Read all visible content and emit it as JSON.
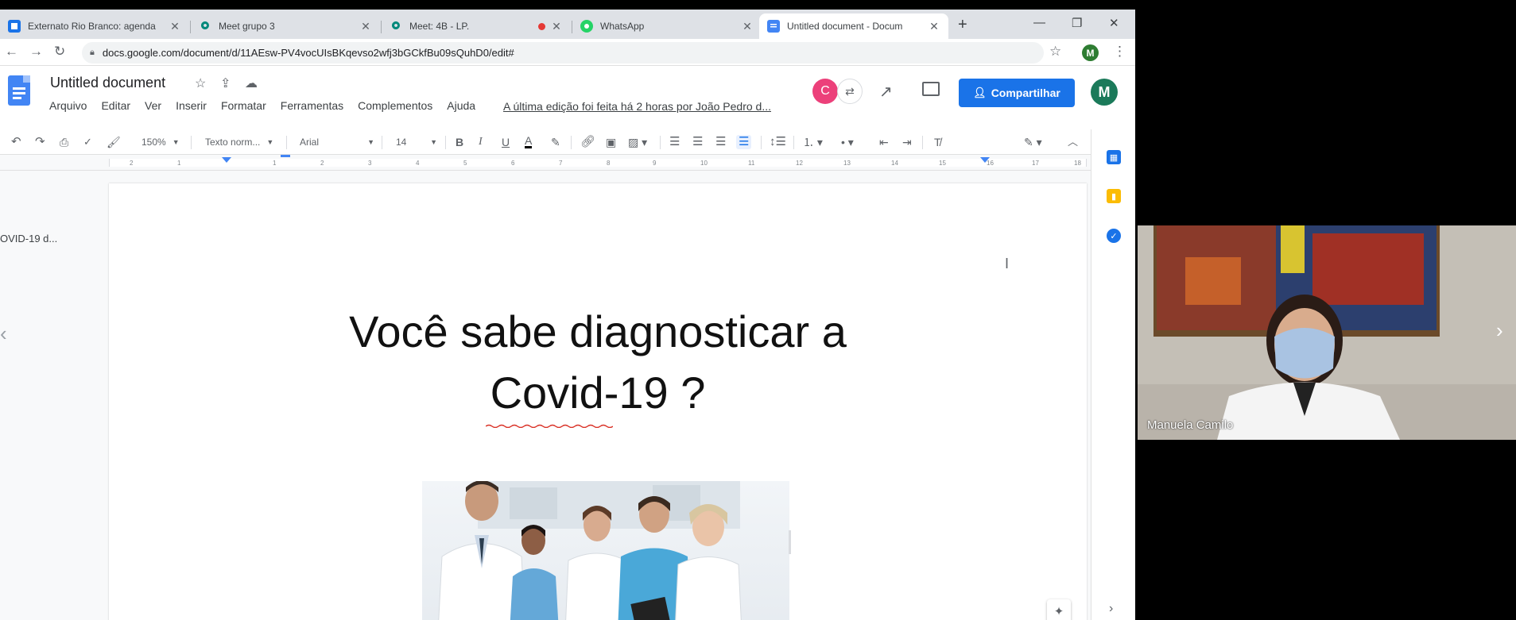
{
  "browser": {
    "tabs": [
      {
        "title": "Externato Rio Branco: agenda",
        "favicon": "google-calendar-icon",
        "favicon_color": "#1a73e8",
        "active": false
      },
      {
        "title": "Meet grupo 3",
        "favicon": "google-meet-icon",
        "favicon_color": "#00897b",
        "active": false
      },
      {
        "title": "Meet: 4B - LP.",
        "favicon": "google-meet-icon",
        "favicon_color": "#00897b",
        "active": false,
        "recording": true
      },
      {
        "title": "WhatsApp",
        "favicon": "whatsapp-icon",
        "favicon_color": "#25d366",
        "active": false
      },
      {
        "title": "Untitled document - Docum",
        "favicon": "google-docs-icon",
        "favicon_color": "#4285f4",
        "active": true
      }
    ],
    "new_tab_label": "+",
    "address": "docs.google.com/document/d/11AEsw-PV4vocUIsBKqevso2wfj3bGCkfBu09sQuhD0/edit#",
    "profile_initial": "M"
  },
  "docs": {
    "title": "Untitled document",
    "menu": [
      "Arquivo",
      "Editar",
      "Ver",
      "Inserir",
      "Formatar",
      "Ferramentas",
      "Complementos",
      "Ajuda"
    ],
    "last_edit": "A última edição foi feita há 2 horas por João Pedro d...",
    "collaborator_initial": "C",
    "share_label": "Compartilhar",
    "account_initial": "M",
    "brand_color": "#1a73e8"
  },
  "toolbar": {
    "zoom": "150%",
    "style": "Texto norm...",
    "font": "Arial",
    "size": "14",
    "ruler_numbers": [
      "2",
      "1",
      "1",
      "2",
      "3",
      "4",
      "5",
      "6",
      "7",
      "8",
      "9",
      "10",
      "11",
      "12",
      "13",
      "14",
      "15",
      "16",
      "17",
      "18"
    ]
  },
  "outline": {
    "item": "OVID-19 d..."
  },
  "document": {
    "heading_line1": "Você sabe diagnosticar a",
    "heading_line2": "Covid-19 ?"
  },
  "webcam": {
    "participant_name": "Manuela Camilo"
  }
}
